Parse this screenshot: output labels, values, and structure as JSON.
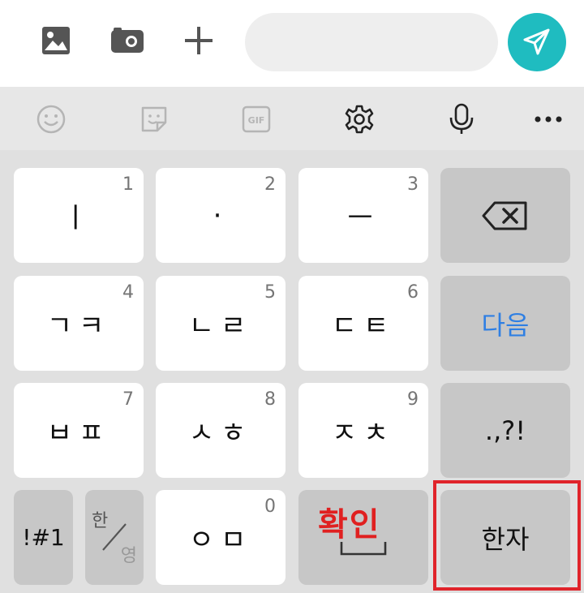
{
  "compose_bar": {
    "icons": [
      "image-icon",
      "camera-icon",
      "plus-icon"
    ],
    "message_input": {
      "value": "",
      "placeholder": ""
    },
    "send_icon": "send-icon",
    "send_color": "#1fbcc0"
  },
  "toolbar": {
    "icons": [
      "emoji-icon",
      "sticker-icon",
      "gif-icon",
      "settings-icon",
      "microphone-icon",
      "more-icon"
    ],
    "gif_label": "GIF"
  },
  "keypad": {
    "row1": [
      {
        "num": "1",
        "label": "ㅣ"
      },
      {
        "num": "2",
        "label": "·"
      },
      {
        "num": "3",
        "label": "ㅡ"
      }
    ],
    "backspace_icon": "backspace-icon",
    "row2": [
      {
        "num": "4",
        "label": "ㄱㅋ"
      },
      {
        "num": "5",
        "label": "ㄴㄹ"
      },
      {
        "num": "6",
        "label": "ㄷㅌ"
      }
    ],
    "next_label": "다음",
    "row3": [
      {
        "num": "7",
        "label": "ㅂㅍ"
      },
      {
        "num": "8",
        "label": "ㅅㅎ"
      },
      {
        "num": "9",
        "label": "ㅈㅊ"
      }
    ],
    "punct_label": ".,?!",
    "symbols_label": "!#1",
    "lang_toggle": {
      "top": "한",
      "bottom": "영"
    },
    "zero": {
      "num": "0",
      "label": "ㅇㅁ"
    },
    "space_icon": "space-icon",
    "hanja_label": "한자"
  },
  "annotation": {
    "overlay_text": "확인",
    "overlay_color": "#e02020",
    "highlight_color": "#e0242b"
  }
}
